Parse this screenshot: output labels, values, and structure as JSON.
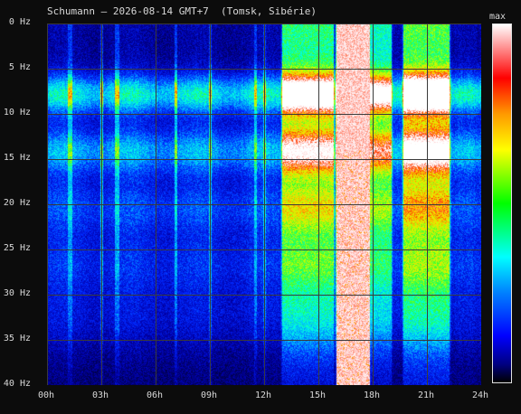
{
  "title": "Schumann — 2026-08-14 GMT+7  (Tomsk, Sibérie)",
  "colorbar_label": "max",
  "chart_data": {
    "type": "heatmap",
    "title": "Schumann — 2026-08-14 GMT+7  (Tomsk, Sibérie)",
    "x_ticks": [
      "00h",
      "03h",
      "06h",
      "09h",
      "12h",
      "15h",
      "18h",
      "21h",
      "24h"
    ],
    "y_ticks": [
      "0 Hz",
      "5 Hz",
      "10 Hz",
      "15 Hz",
      "20 Hz",
      "25 Hz",
      "30 Hz",
      "35 Hz",
      "40 Hz"
    ],
    "xlim": [
      0,
      24
    ],
    "ylim": [
      0,
      40
    ],
    "y_direction": "down",
    "grid": true,
    "colorbar": {
      "label": "max",
      "position": "right",
      "colors": [
        "#ffffff",
        "#ff0000",
        "#ff9900",
        "#ffff00",
        "#00ff00",
        "#00ffff",
        "#0080ff",
        "#0000ff",
        "#000080",
        "#000000"
      ]
    },
    "resonance_bands_hz": [
      7.8,
      14.1,
      20.3,
      26.4,
      32.5
    ],
    "band_intensity": [
      0.62,
      0.5,
      0.32,
      0.26,
      0.2
    ],
    "high_activity_periods_h": [
      {
        "start": 13.0,
        "end": 15.8,
        "intensity": 0.72
      },
      {
        "start": 16.0,
        "end": 17.8,
        "intensity": 1.0
      },
      {
        "start": 17.9,
        "end": 19.0,
        "intensity": 0.62
      },
      {
        "start": 19.7,
        "end": 22.2,
        "intensity": 0.8
      }
    ],
    "vertical_bursts_h": [
      1.2,
      1.3,
      3.0,
      3.8,
      3.9,
      7.1,
      9.0,
      11.5,
      12.0
    ]
  }
}
